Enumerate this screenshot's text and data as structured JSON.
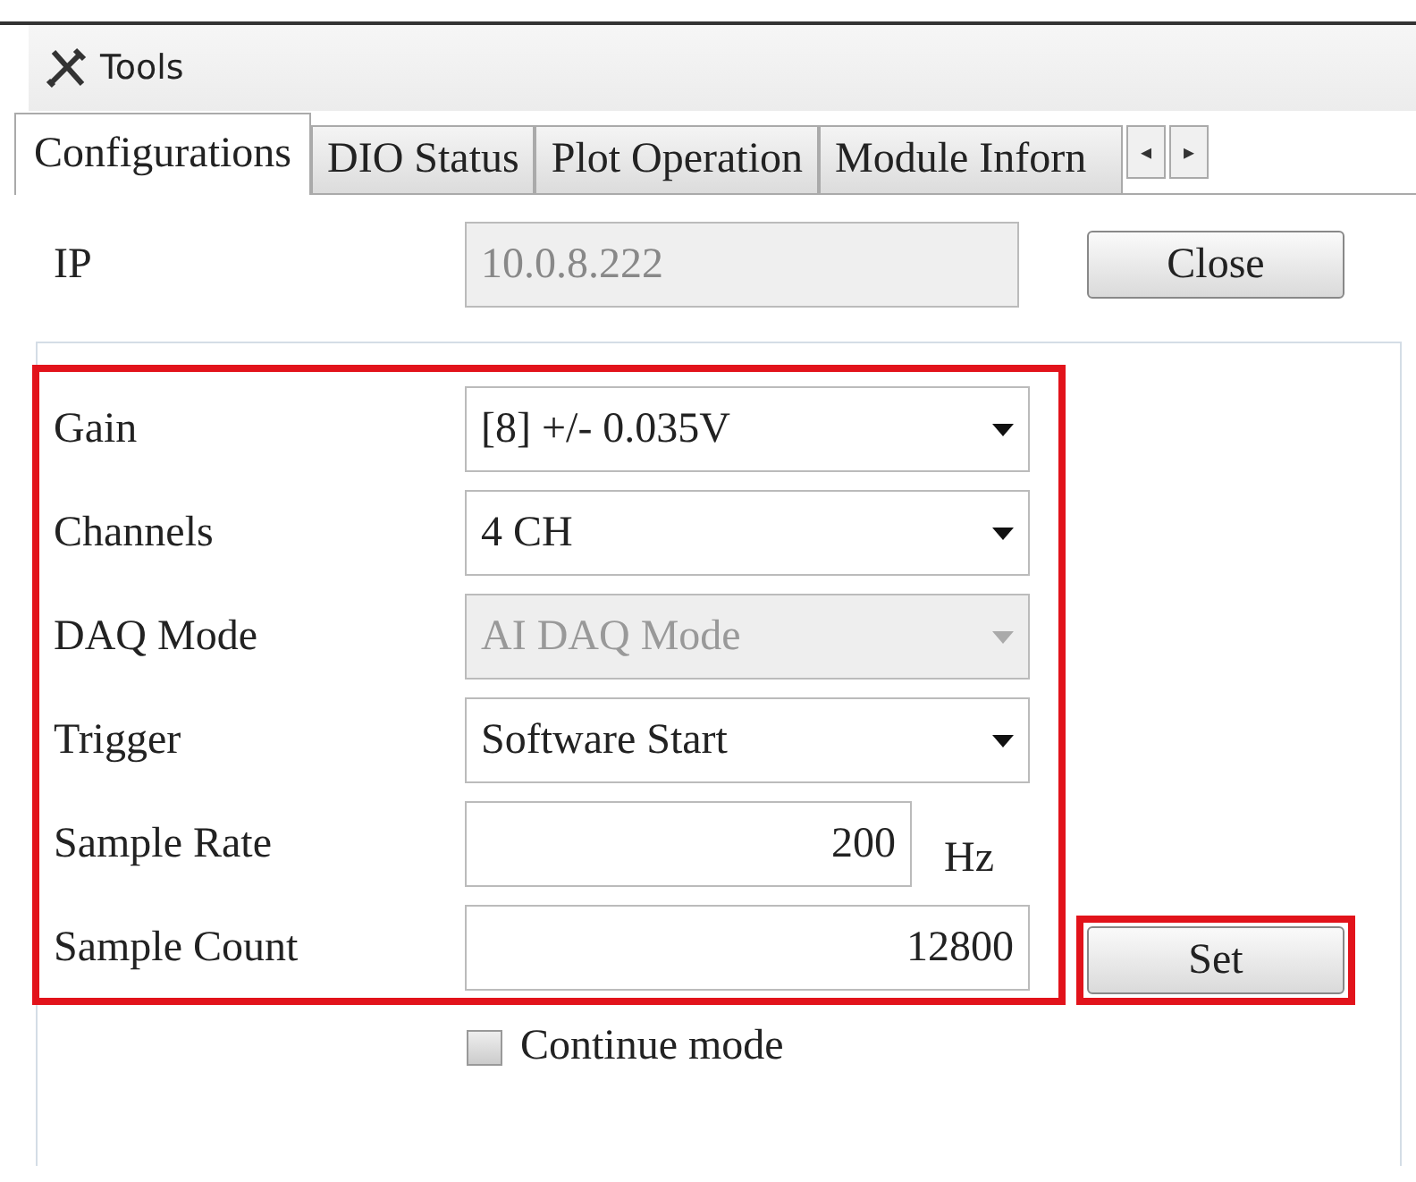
{
  "toolbar": {
    "title": "Tools"
  },
  "tabs": [
    {
      "label": "Configurations",
      "selected": true
    },
    {
      "label": "DIO Status",
      "selected": false
    },
    {
      "label": "Plot Operation",
      "selected": false
    },
    {
      "label": "Module Inforn",
      "selected": false
    }
  ],
  "tab_scroll": {
    "left": "◂",
    "right": "▸"
  },
  "ip": {
    "label": "IP",
    "value": "10.0.8.222",
    "disabled": true
  },
  "close_button": "Close",
  "fields": [
    {
      "kind": "dropdown",
      "label": "Gain",
      "value": "[8] +/- 0.035V",
      "disabled": false
    },
    {
      "kind": "dropdown",
      "label": "Channels",
      "value": "4 CH",
      "disabled": false
    },
    {
      "kind": "dropdown",
      "label": "DAQ Mode",
      "value": "AI DAQ Mode",
      "disabled": true
    },
    {
      "kind": "dropdown",
      "label": "Trigger",
      "value": "Software Start",
      "disabled": false
    },
    {
      "kind": "number",
      "label": "Sample Rate",
      "value": "200",
      "unit": "Hz",
      "disabled": false
    },
    {
      "kind": "number",
      "label": "Sample Count",
      "value": "12800",
      "disabled": false
    }
  ],
  "set_button": "Set",
  "continue_mode": {
    "label": "Continue mode",
    "checked": false
  }
}
